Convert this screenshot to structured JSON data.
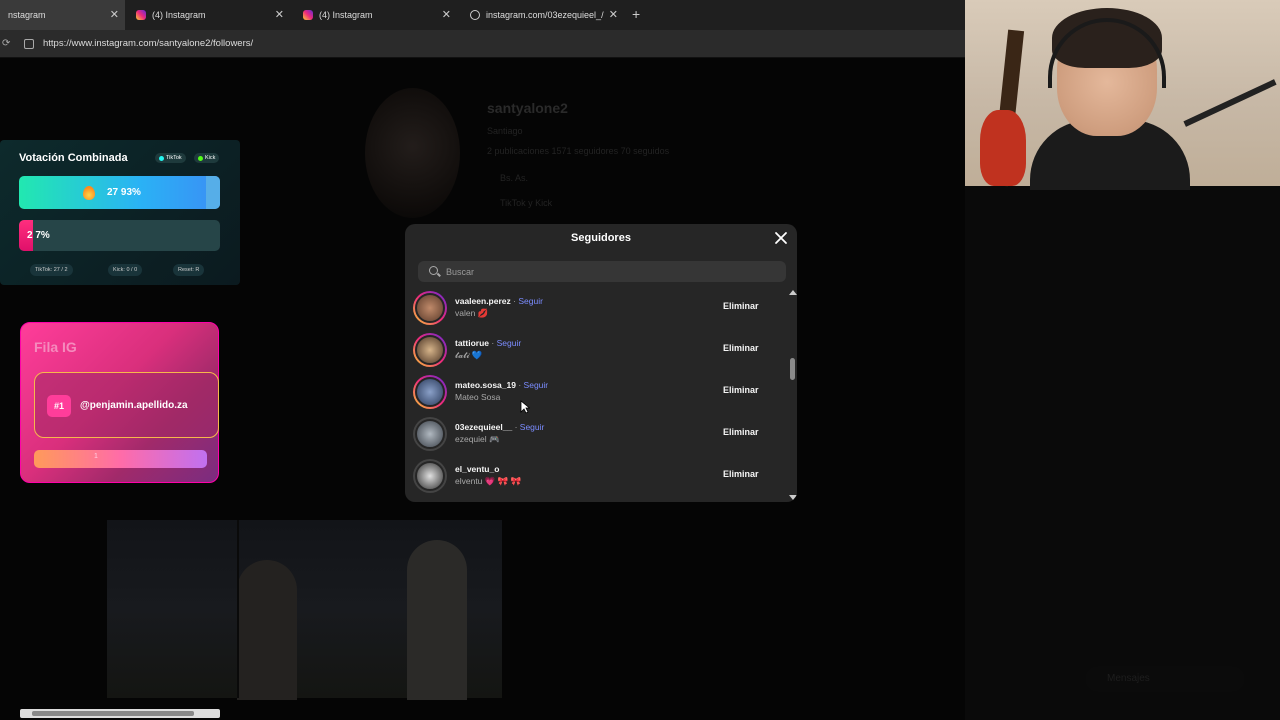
{
  "browser": {
    "tabs": [
      {
        "label": "nstagram",
        "icon": "instagram-icon"
      },
      {
        "label": "(4) Instagram",
        "icon": "instagram-icon"
      },
      {
        "label": "(4) Instagram",
        "icon": "instagram-icon"
      },
      {
        "label": "instagram.com/03ezequieel_/",
        "icon": "globe-icon"
      }
    ],
    "url": "https://www.instagram.com/santyalone2/followers/"
  },
  "background_profile": {
    "username": "santyalone2",
    "name": "Santiago",
    "stats": "2 publicaciones   1571 seguidores   70 seguidos",
    "bio_lines": [
      "Bs. As.",
      "TikTok y Kick"
    ],
    "messages_label": "Mensajes"
  },
  "vote_widget": {
    "title": "Votación Combinada",
    "badge_tiktok": "TikTok",
    "badge_kick": "Kick",
    "option1_text": "27  93%",
    "option1_fraction": 0.93,
    "option2_text": "2  7%",
    "option2_fraction": 0.07,
    "footer_tiktok": "TikTok: 27 / 2",
    "footer_kick": "Kick: 0 / 0",
    "footer_reset": "Reset: R",
    "colors": {
      "bar1": "#22e8b0",
      "bar2": "#ff2e7e"
    }
  },
  "fila_widget": {
    "title": "Fila IG",
    "position": "#1",
    "user": "@penjamin.apellido.za",
    "bar_label": "1"
  },
  "modal": {
    "title": "Seguidores",
    "search_placeholder": "Buscar",
    "remove_label": "Eliminar",
    "follow_label": "Seguir",
    "followers": [
      {
        "username": "vaaleen.perez",
        "full_name": "valen 💋",
        "story_ring": true
      },
      {
        "username": "tattiorue",
        "full_name": "𝓽𝓪𝓽𝓲 💙",
        "story_ring": true
      },
      {
        "username": "mateo.sosa_19",
        "full_name": "Mateo Sosa",
        "story_ring": true
      },
      {
        "username": "03ezequieel__",
        "full_name": "ezequiel 🎮",
        "story_ring": false
      },
      {
        "username": "el_ventu_o",
        "full_name": "elventu 💗 🎀 🎀",
        "story_ring": false
      }
    ]
  }
}
